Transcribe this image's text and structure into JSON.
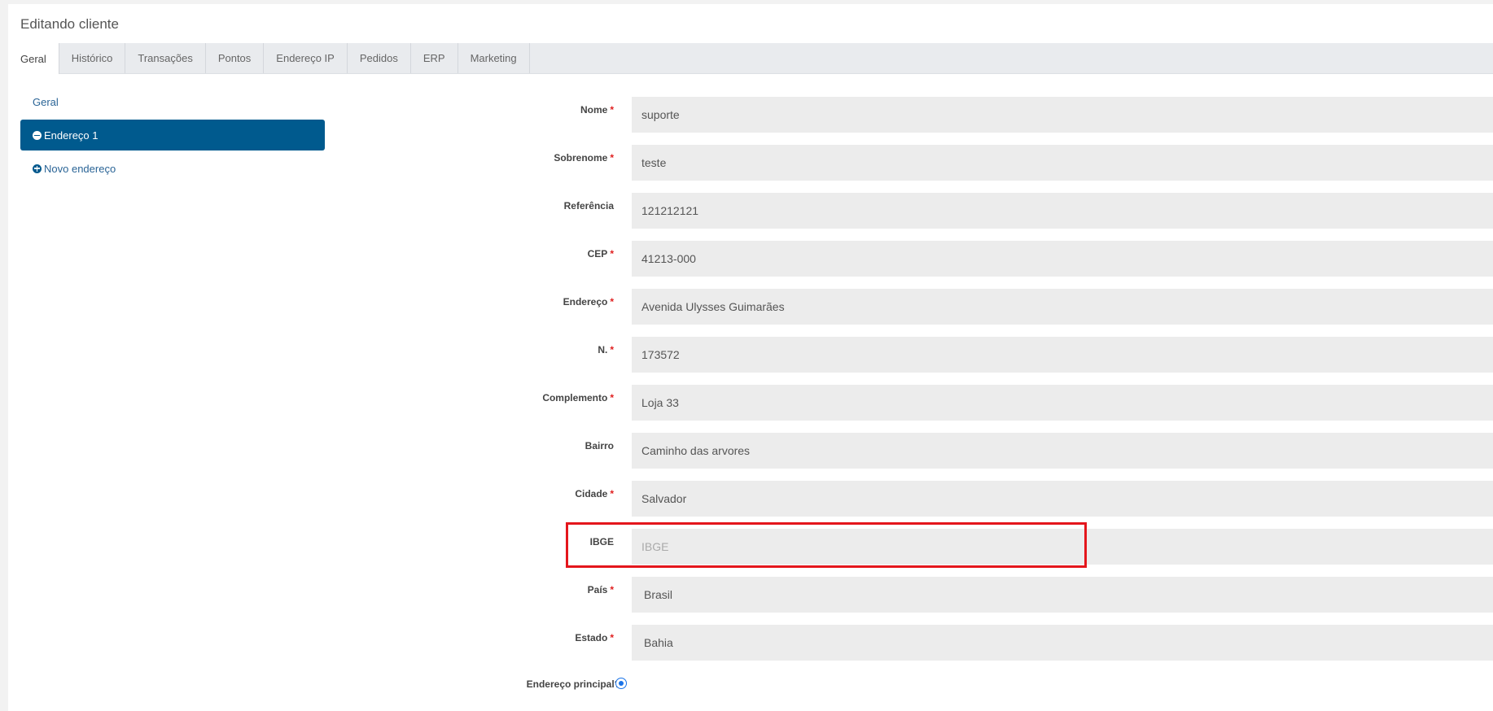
{
  "page": {
    "title": "Editando cliente"
  },
  "tabs": [
    {
      "label": "Geral"
    },
    {
      "label": "Histórico"
    },
    {
      "label": "Transações"
    },
    {
      "label": "Pontos"
    },
    {
      "label": "Endereço IP"
    },
    {
      "label": "Pedidos"
    },
    {
      "label": "ERP"
    },
    {
      "label": "Marketing"
    }
  ],
  "sidebar": {
    "general_link": "Geral",
    "active_address": "Endereço 1",
    "new_address": "Novo endereço"
  },
  "form": {
    "nome": {
      "label": "Nome",
      "value": "suporte"
    },
    "sobrenome": {
      "label": "Sobrenome",
      "value": "teste"
    },
    "referencia": {
      "label": "Referência",
      "value": "121212121"
    },
    "cep": {
      "label": "CEP",
      "value": "41213-000"
    },
    "endereco": {
      "label": "Endereço",
      "value": "Avenida Ulysses Guimarães"
    },
    "numero": {
      "label": "N.",
      "value": "173572"
    },
    "complemento": {
      "label": "Complemento",
      "value": "Loja 33"
    },
    "bairro": {
      "label": "Bairro",
      "value": "Caminho das arvores"
    },
    "cidade": {
      "label": "Cidade",
      "value": "Salvador"
    },
    "ibge": {
      "label": "IBGE",
      "placeholder": "IBGE"
    },
    "pais": {
      "label": "País",
      "value": "Brasil"
    },
    "estado": {
      "label": "Estado",
      "value": "Bahia"
    },
    "principal": {
      "label": "Endereço principal?",
      "checked": true
    }
  },
  "required_marker": "*",
  "colors": {
    "accent": "#005a8e",
    "required": "#e02020",
    "highlight": "#e4161c",
    "radio": "#1a73e8"
  }
}
